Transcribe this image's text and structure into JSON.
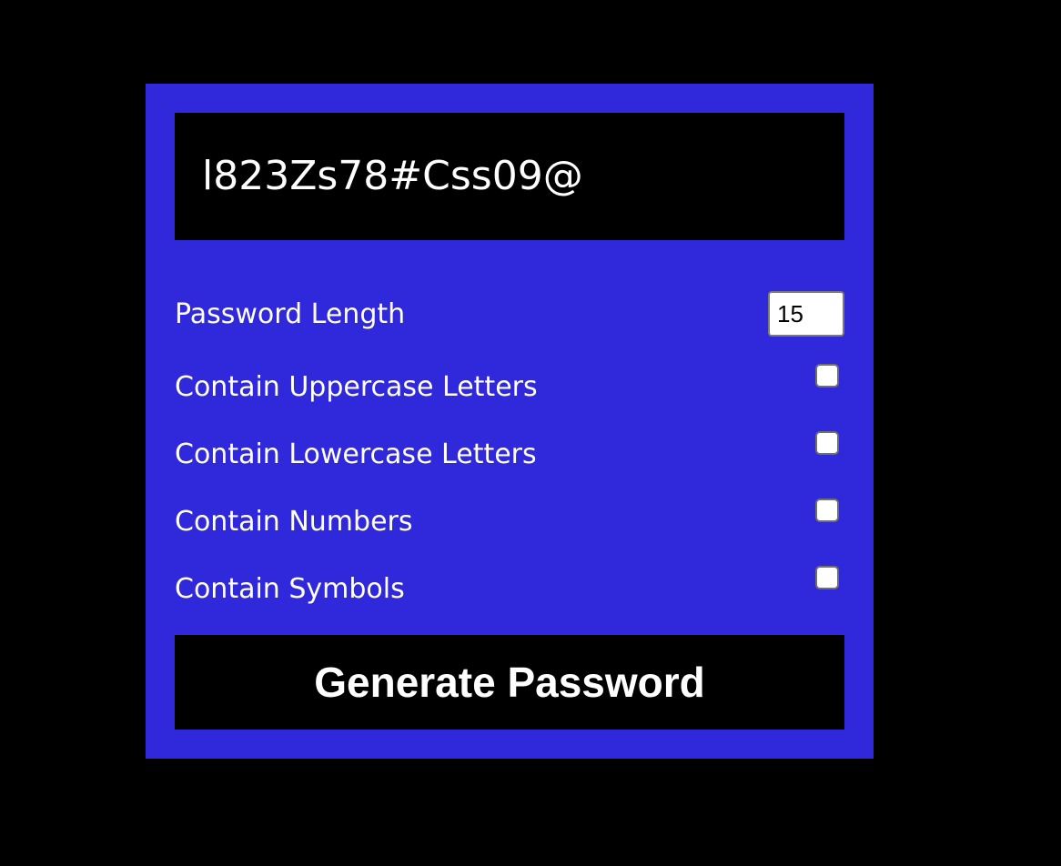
{
  "result": {
    "password": "l823Zs78#Css09@"
  },
  "settings": {
    "length_label": "Password Length",
    "length_value": "15",
    "uppercase_label": "Contain Uppercase Letters",
    "uppercase_checked": false,
    "lowercase_label": "Contain Lowercase Letters",
    "lowercase_checked": false,
    "numbers_label": "Contain Numbers",
    "numbers_checked": false,
    "symbols_label": "Contain Symbols",
    "symbols_checked": false
  },
  "actions": {
    "generate_label": "Generate Password"
  },
  "colors": {
    "page_background": "#000000",
    "card_background": "#3028db",
    "panel_background": "#000000",
    "text": "#ffffff"
  }
}
